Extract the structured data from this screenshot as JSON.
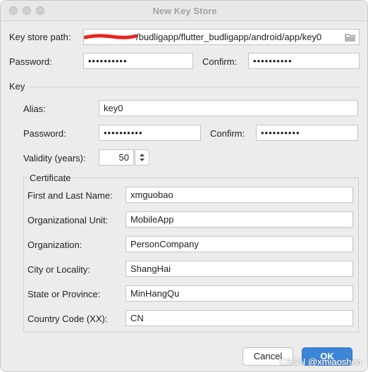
{
  "window": {
    "title": "New Key Store"
  },
  "keystore": {
    "path_label": "Key store path:",
    "path_value": "/budligapp/flutter_budligapp/android/app/key0",
    "password_label": "Password:",
    "password_dots": "••••••••••",
    "confirm_label": "Confirm:",
    "confirm_dots": "••••••••••"
  },
  "key": {
    "section_label": "Key",
    "alias_label": "Alias:",
    "alias_value": "key0",
    "password_label": "Password:",
    "password_dots": "••••••••••",
    "confirm_label": "Confirm:",
    "confirm_dots": "••••••••••",
    "validity_label": "Validity (years):",
    "validity_value": "50"
  },
  "certificate": {
    "section_label": "Certificate",
    "fields": [
      {
        "label": "First and Last Name:",
        "value": "xmguobao"
      },
      {
        "label": "Organizational Unit:",
        "value": "MobileApp"
      },
      {
        "label": "Organization:",
        "value": "PersonCompany"
      },
      {
        "label": "City or Locality:",
        "value": "ShangHai"
      },
      {
        "label": "State or Province:",
        "value": "MinHangQu"
      },
      {
        "label": "Country Code (XX):",
        "value": "CN"
      }
    ]
  },
  "buttons": {
    "cancel": "Cancel",
    "ok": "OK"
  },
  "watermark": "CSDN @xmiaoshen",
  "colors": {
    "accent": "#3b86d6",
    "redaction": "#e8261f"
  },
  "icons": {
    "folder": "folder-icon",
    "stepper": "stepper-arrows-icon"
  }
}
